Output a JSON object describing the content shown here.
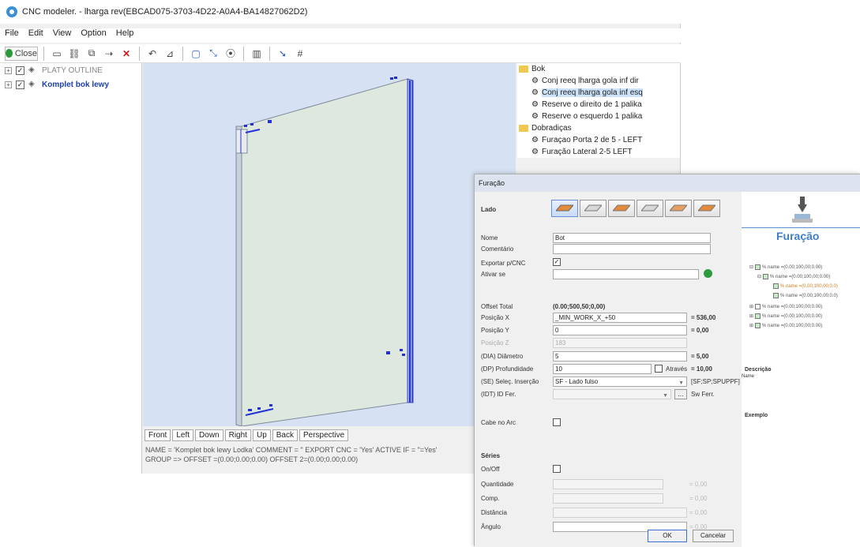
{
  "window": {
    "title": "CNC modeler. - lharga rev(EBCAD075-3703-4D22-A0A4-BA14827062D2)"
  },
  "menu": [
    "File",
    "Edit",
    "View",
    "Option",
    "Help"
  ],
  "toolbar": {
    "close_label": "Close"
  },
  "left_tree": [
    {
      "label": "PLATY OUTLINE",
      "style": "gray"
    },
    {
      "label": "Komplet bok lewy",
      "style": "bold"
    }
  ],
  "view_tabs": [
    "Front",
    "Left",
    "Down",
    "Right",
    "Up",
    "Back",
    "Perspective"
  ],
  "status": {
    "line1": "NAME = 'Komplet bok lewy  Lodka'  COMMENT = ''  EXPORT CNC = 'Yes'  ACTIVE IF = \"=Yes'",
    "line2": "GROUP =>    OFFSET =(0.00;0.00;0.00)   OFFSET 2=(0.00;0.00;0.00)"
  },
  "right_tree": [
    {
      "label": "Bok",
      "kind": "folder",
      "indent": 0
    },
    {
      "label": "Conj reeq lharga gola inf dir",
      "kind": "item",
      "indent": 1
    },
    {
      "label": "Conj reeq lharga gola inf esq",
      "kind": "item",
      "indent": 1,
      "selected": true
    },
    {
      "label": "Reserve o direito de 1 palika",
      "kind": "item",
      "indent": 1
    },
    {
      "label": "Reserve o esquerdo 1 palika",
      "kind": "item",
      "indent": 1
    },
    {
      "label": "Dobradiças",
      "kind": "folder",
      "indent": 0
    },
    {
      "label": "Furaçao Porta 2 de 5 - LEFT",
      "kind": "item",
      "indent": 1
    },
    {
      "label": "Furação Lateral 2-5 LEFT",
      "kind": "item",
      "indent": 1
    }
  ],
  "dialog": {
    "title": "Furação",
    "lado_label": "Lado",
    "fields": {
      "nome_label": "Nome",
      "nome_value": "Bot",
      "comentario_label": "Comentário",
      "exportar_label": "Exportar p/CNC",
      "ativar_label": "Ativar se",
      "offset_label": "Offset Total",
      "offset_value": "(0.00;500,50;0,00)",
      "posx_label": "Posição X",
      "posx_value": "_MIN_WORK_X_+50",
      "posx_result": "= 536,00",
      "posy_label": "Posição Y",
      "posy_value": "0",
      "posy_result": "= 0,00",
      "posz_label": "Posição Z",
      "posz_value": "183",
      "diam_label": "(DIA) Diâmetro",
      "diam_value": "5",
      "diam_result": "= 5,00",
      "prof_label": "(DP) Profundidade",
      "prof_value": "10",
      "prof_check_label": "Através",
      "prof_result": "= 10,00",
      "sel_label": "(SE) Seleç. Inserção",
      "sel_value": "SF - Lado fulso",
      "sel_code": "[SF;SP;SPUPPF]",
      "ferr_label": "(IDT) ID Fer.",
      "ferr_result": "Sw Ferr.",
      "cabe_label": "Cabe no Arc"
    },
    "series_title": "Séries",
    "series": {
      "on_label": "On/Off",
      "quant_label": "Quantidade",
      "quant_result": "= 0,00",
      "comp_label": "Comp.",
      "comp_result": "= 0,00",
      "dist_label": "Distância",
      "dist_result": "= 0,00",
      "ang_label": "Ângulo",
      "ang_result": "= 0,00"
    },
    "ok_label": "OK",
    "cancel_label": "Cancelar",
    "right": {
      "title": "Furação",
      "tree": [
        {
          "label": "% name =(0.00;100,00;0.00)",
          "indent": 0,
          "checked": true
        },
        {
          "label": "% name =(0.00;100,00;0.00)",
          "indent": 1,
          "checked": true
        },
        {
          "label": "% name =(0.00;100,00;0.0)",
          "indent": 2,
          "checked": true,
          "highlight": true
        },
        {
          "label": "% name =(0.00;100,00;0.0)",
          "indent": 2,
          "checked": true
        },
        {
          "label": "% name =(0.00;100,00;0.00)",
          "indent": 0,
          "checked": false
        },
        {
          "label": "% name =(0.00;100,00;0.00)",
          "indent": 0,
          "checked": true
        },
        {
          "label": "% name =(0.00;100,00;0.00)",
          "indent": 0,
          "checked": true
        }
      ],
      "descricao_label": "Descrição",
      "name_label": "Name",
      "exemplo_label": "Exemplo"
    }
  }
}
